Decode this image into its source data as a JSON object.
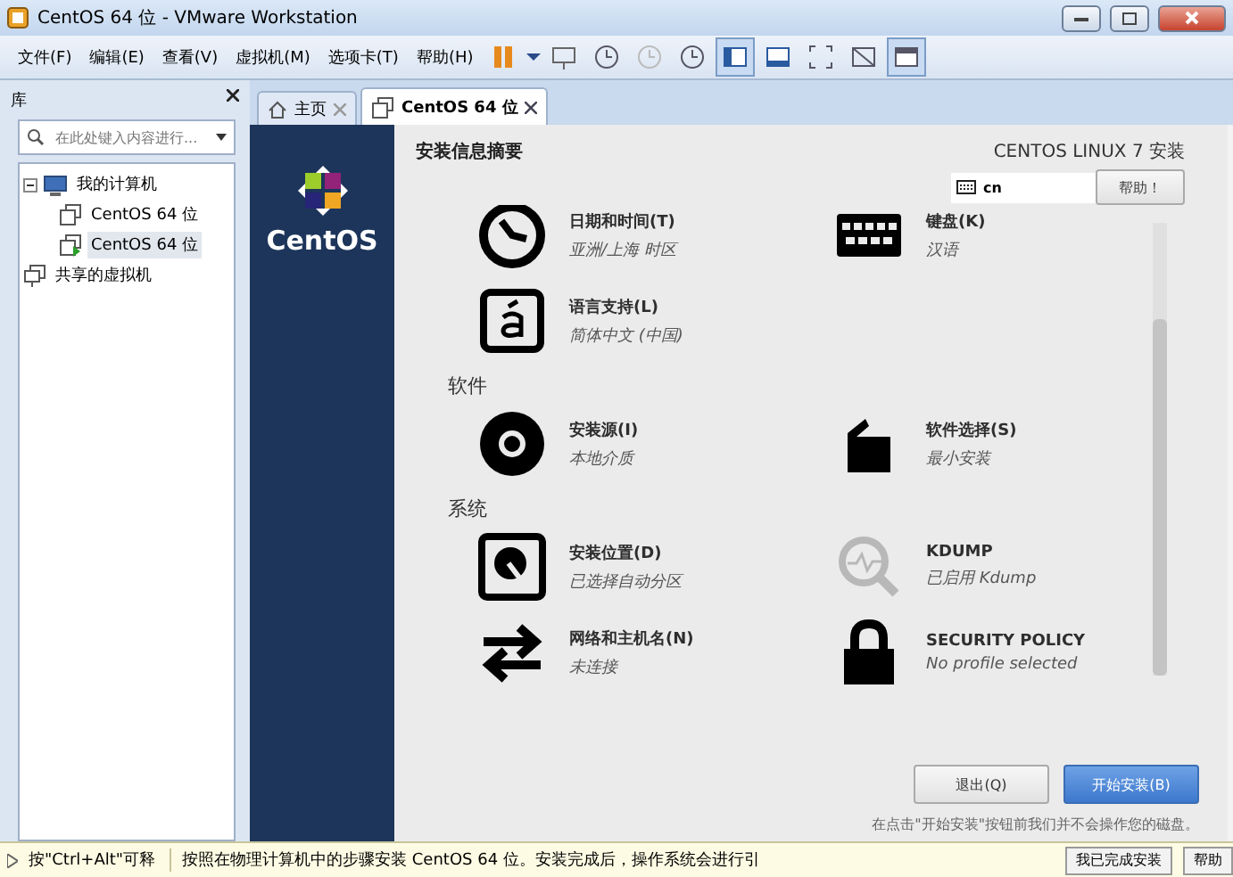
{
  "window": {
    "title": "CentOS 64 位 - VMware Workstation"
  },
  "menu": [
    "文件(F)",
    "编辑(E)",
    "查看(V)",
    "虚拟机(M)",
    "选项卡(T)",
    "帮助(H)"
  ],
  "library": {
    "title": "库",
    "search": {
      "placeholder": "在此处键入内容进行..."
    },
    "tree": [
      {
        "label": "我的计算机",
        "kind": "computer",
        "expanded": true,
        "children": [
          {
            "label": "CentOS 64 位",
            "kind": "vm",
            "selected": false
          },
          {
            "label": "CentOS 64 位",
            "kind": "vm-running",
            "selected": true
          }
        ]
      },
      {
        "label": "共享的虚拟机",
        "kind": "shared"
      }
    ]
  },
  "tabs": [
    {
      "label": "主页",
      "kind": "home",
      "selected": false
    },
    {
      "label": "CentOS 64 位",
      "kind": "vm",
      "selected": true
    }
  ],
  "installer": {
    "brand": "CentOS",
    "title": "安装信息摘要",
    "product": "CENTOS LINUX 7 安装",
    "keyboard": "cn",
    "help": "帮助！",
    "sections": [
      {
        "spokes": [
          {
            "kind": "clock",
            "title": "日期和时间(T)",
            "status": "亚洲/上海 时区",
            "disabled": false
          },
          {
            "kind": "keyboard",
            "title": "键盘(K)",
            "status": "汉语",
            "disabled": false
          },
          {
            "kind": "language",
            "title": "语言支持(L)",
            "status": "简体中文 (中国)",
            "disabled": false
          }
        ]
      },
      {
        "title": "软件",
        "spokes": [
          {
            "kind": "disc",
            "title": "安装源(I)",
            "status": "本地介质",
            "disabled": false
          },
          {
            "kind": "package",
            "title": "软件选择(S)",
            "status": "最小安装",
            "disabled": false
          }
        ]
      },
      {
        "title": "系统",
        "spokes": [
          {
            "kind": "disk",
            "title": "安装位置(D)",
            "status": "已选择自动分区",
            "disabled": false
          },
          {
            "kind": "search",
            "title": "KDUMP",
            "status": "已启用 Kdump",
            "disabled": true
          },
          {
            "kind": "network",
            "title": "网络和主机名(N)",
            "status": "未连接",
            "disabled": false
          },
          {
            "kind": "lock",
            "title": "SECURITY POLICY",
            "status": "No profile selected",
            "disabled": false
          }
        ]
      }
    ],
    "buttons": [
      {
        "label": "退出(Q)",
        "primary": false
      },
      {
        "label": "开始安装(B)",
        "primary": true
      }
    ],
    "note": "在点击\"开始安装\"按钮前我们并不会操作您的磁盘。"
  },
  "hint_bar": {
    "hint": "按\"Ctrl+Alt\"可释",
    "message": "按照在物理计算机中的步骤安装 CentOS 64 位。安装完成后，操作系统会进行引",
    "buttons": [
      "我已完成安装",
      "帮助"
    ]
  }
}
